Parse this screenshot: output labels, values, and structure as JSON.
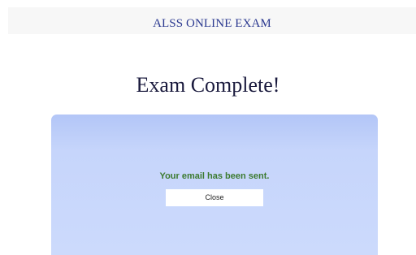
{
  "header": {
    "title": "ALSS ONLINE EXAM"
  },
  "main": {
    "heading": "Exam Complete!",
    "panel": {
      "message": "Your email has been sent.",
      "close_label": "Close"
    }
  },
  "colors": {
    "header_text": "#2b3990",
    "panel_background": "#c6d5fb",
    "success_text": "#3c7a2f"
  }
}
